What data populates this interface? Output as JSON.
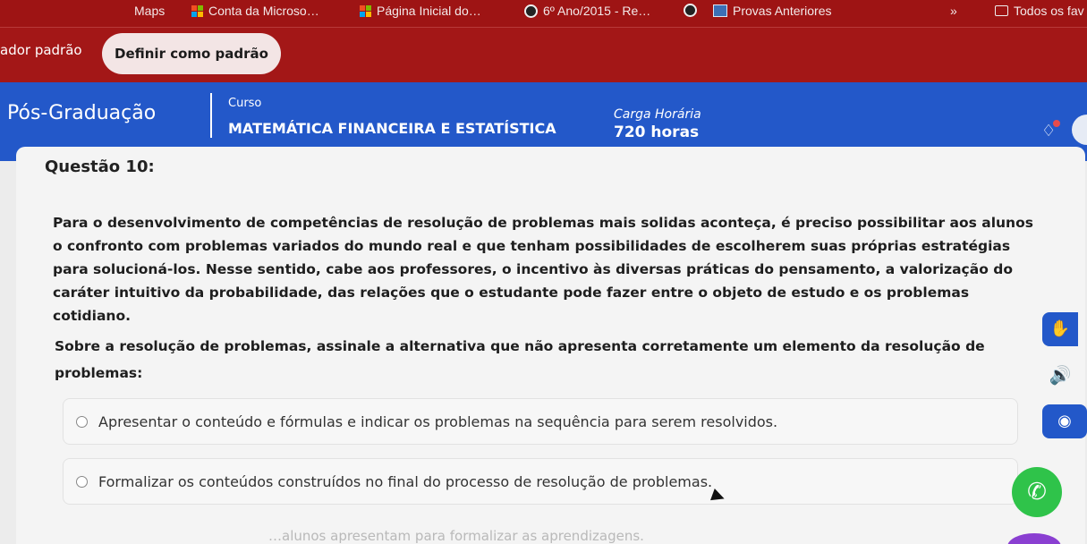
{
  "bookmarks": {
    "items": [
      {
        "label": "Maps",
        "icon": "maps-icon"
      },
      {
        "label": "Conta da Microso…",
        "icon": "microsoft-icon"
      },
      {
        "label": "Página Inicial do…",
        "icon": "microsoft-icon"
      },
      {
        "label": "6º Ano/2015 - Re…",
        "icon": "site-icon"
      },
      {
        "label": "Provas Anteriores",
        "icon": "image-icon"
      }
    ],
    "overflow": "»",
    "all_label": "Todos os fav"
  },
  "default_bar": {
    "message": "ador padrão",
    "button_label": "Definir como padrão"
  },
  "course": {
    "program": "Pós-Graduação",
    "course_label": "Curso",
    "course_name": "MATEMÁTICA FINANCEIRA E ESTATÍSTICA",
    "hours_label": "Carga Horária",
    "hours_value": "720 horas"
  },
  "question": {
    "title": "Questão 10:",
    "body": "Para o desenvolvimento de competências de resolução de problemas mais solidas aconteça, é preciso possibilitar aos alunos o confronto com problemas variados do mundo real e que tenham possibilidades de escolherem suas próprias estratégias para solucioná-los. Nesse sentido, cabe aos professores, o incentivo às diversas práticas do pensamento, a valorização do caráter intuitivo da probabilidade, das relações que o estudante pode fazer entre o objeto de estudo e os problemas cotidiano.",
    "ask": "Sobre a resolução de problemas, assinale a alternativa que não apresenta corretamente um elemento da resolução de problemas:",
    "options": [
      "Apresentar o conteúdo e fórmulas e indicar os problemas na sequência para serem resolvidos.",
      "Formalizar os conteúdos construídos no final do processo de resolução de problemas."
    ],
    "faint_option": "…alunos apresentam para formalizar as aprendizagens."
  },
  "colors": {
    "bookmarks_bg": "#9e1414",
    "default_bar_bg": "#a31717",
    "course_bg": "#2358c9",
    "panel_bg": "#f4f4f4"
  }
}
